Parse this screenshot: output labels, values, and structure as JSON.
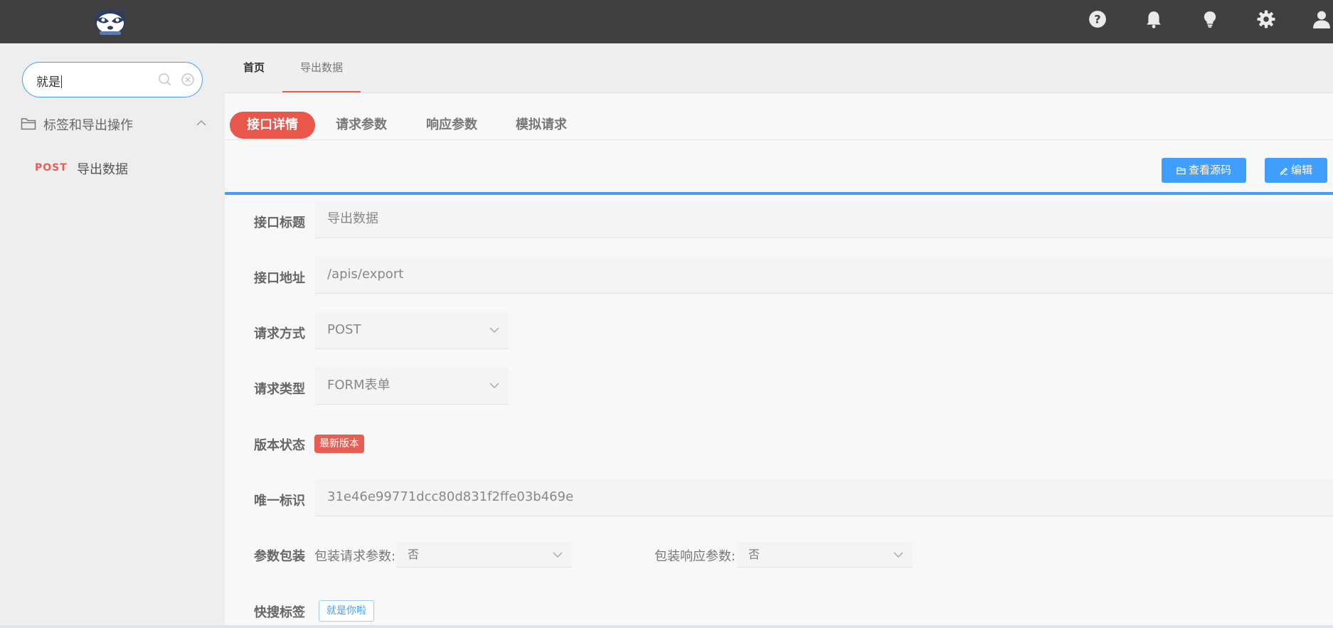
{
  "sidebar": {
    "search": {
      "value": "就是"
    },
    "group": {
      "label": "标签和导出操作"
    },
    "items": [
      {
        "method": "POST",
        "label": "导出数据"
      }
    ]
  },
  "page_tabs": [
    {
      "label": "首页"
    },
    {
      "label": "导出数据"
    }
  ],
  "detail_tabs": [
    {
      "label": "接口详情"
    },
    {
      "label": "请求参数"
    },
    {
      "label": "响应参数"
    },
    {
      "label": "模拟请求"
    }
  ],
  "actions": {
    "view_source": "查看源码",
    "edit": "编辑"
  },
  "form": {
    "title": {
      "label": "接口标题",
      "value": "导出数据"
    },
    "url": {
      "label": "接口地址",
      "value": "/apis/export"
    },
    "method": {
      "label": "请求方式",
      "value": "POST"
    },
    "type": {
      "label": "请求类型",
      "value": "FORM表单"
    },
    "version": {
      "label": "版本状态",
      "badge": "最新版本"
    },
    "uid": {
      "label": "唯一标识",
      "value": "31e46e99771dcc80d831f2ffe03b469e"
    },
    "wrap": {
      "label": "参数包装",
      "request_label": "包装请求参数:",
      "request_value": "否",
      "response_label": "包装响应参数:",
      "response_value": "否"
    },
    "tags": {
      "label": "快搜标签",
      "items": [
        "就是你啦"
      ]
    }
  },
  "icons": {
    "logo": "raccoon-logo",
    "topbar": [
      "help-icon",
      "bell-icon",
      "lightbulb-icon",
      "gear-icon",
      "user-icon"
    ]
  },
  "colors": {
    "topbar": "#404040",
    "accent_red": "#e9564a",
    "primary_blue": "#409eff"
  }
}
